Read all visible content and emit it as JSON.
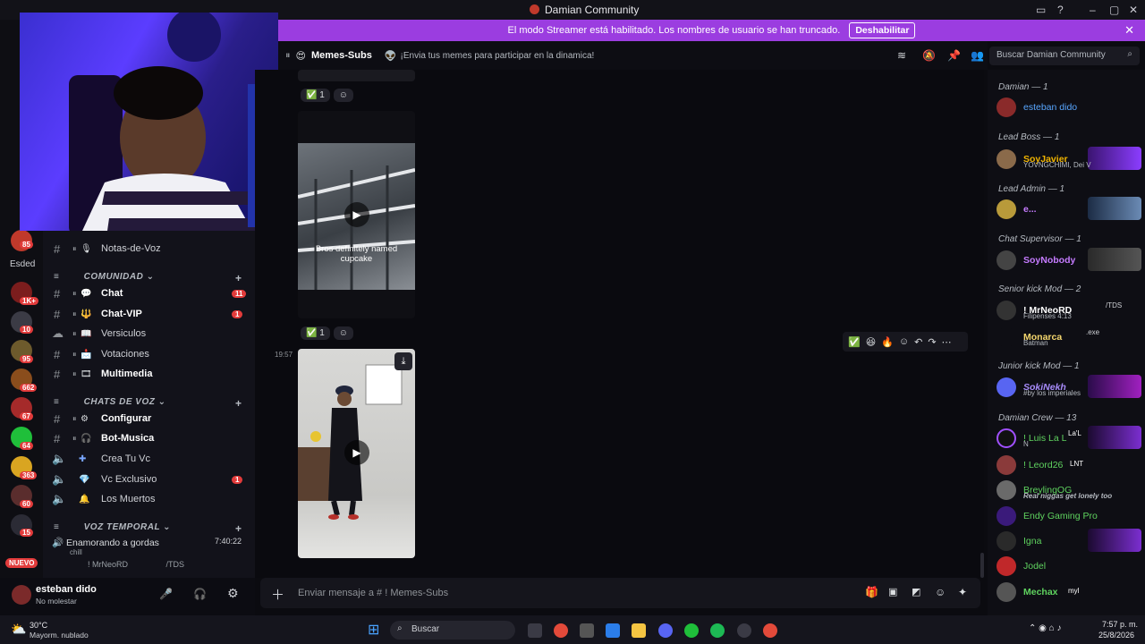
{
  "window": {
    "title": "Damian Community"
  },
  "banner": {
    "text": "El modo Streamer está habilitado. Los nombres de usuario se han truncado.",
    "button": "Deshabilitar"
  },
  "rail": {
    "badges": [
      "85",
      "1K+",
      "10",
      "95",
      "662",
      "67",
      "64",
      "363",
      "60",
      "15"
    ],
    "label": "Esded",
    "new_label": "NUEVO"
  },
  "channels": {
    "items": [
      {
        "name": "Notas-de-Voz",
        "bold": false,
        "badge": ""
      },
      {
        "category": "COMUNIDAD"
      },
      {
        "name": "Chat",
        "bold": true,
        "badge": "11"
      },
      {
        "name": "Chat-VIP",
        "bold": true,
        "badge": "1"
      },
      {
        "name": "Versiculos",
        "bold": false,
        "badge": ""
      },
      {
        "name": "Votaciones",
        "bold": false,
        "badge": ""
      },
      {
        "name": "Multimedia",
        "bold": true,
        "badge": ""
      },
      {
        "category": "CHATS DE VOZ"
      },
      {
        "name": "Configurar",
        "bold": true,
        "badge": ""
      },
      {
        "name": "Bot-Musica",
        "bold": true,
        "badge": ""
      },
      {
        "name": "Crea Tu Vc",
        "bold": false,
        "badge": ""
      },
      {
        "name": "Vc Exclusivo",
        "bold": false,
        "badge": "1"
      },
      {
        "name": "Los Muertos",
        "bold": false,
        "badge": ""
      },
      {
        "category": "VOZ TEMPORAL"
      }
    ],
    "voice_room": {
      "name": "Enamorando a gordas",
      "time": "7:40:22",
      "sub": "chill",
      "member": "! MrNeoRD",
      "member_tag": "/TDS"
    }
  },
  "user": {
    "name": "esteban dido",
    "status": "No molestar"
  },
  "chat": {
    "channel": "Memes-Subs",
    "topic": "¡Envia tus memes para participar en la dinamica!",
    "messages": [
      {
        "reaction_count": "1"
      },
      {
        "caption": "Bros definitely named cupcake",
        "reaction_count": "1"
      },
      {
        "time": "19:57"
      }
    ],
    "placeholder": "Enviar mensaje a # ! Memes-Subs",
    "search_placeholder": "Buscar Damian Community"
  },
  "members": [
    {
      "group": "Damian — 1"
    },
    {
      "name": "esteban dido",
      "color": "#58a6ff"
    },
    {
      "group": "Lead Boss — 1"
    },
    {
      "name": "SoyJavier",
      "sub": "YOVNGCHIMI, Dei V",
      "color": "#f0b400"
    },
    {
      "group": "Lead Admin — 1"
    },
    {
      "name": "e...",
      "color": "#c57bff"
    },
    {
      "group": "Chat Supervisor — 1"
    },
    {
      "name": "SoyNobody",
      "color": "#c57bff"
    },
    {
      "group": "Senior kick Mod — 2"
    },
    {
      "name": "! MrNeoRD",
      "sub": "Filipenses 4:13",
      "tag": "/TDS",
      "color": "#ffffff"
    },
    {
      "name": "Monarca",
      "sub": "Batman",
      "tag": ".exe",
      "color": "#f5d76e"
    },
    {
      "group": "Junior kick Mod — 1"
    },
    {
      "name": "SokiNekh",
      "sub": "#by los imperiales",
      "color": "#a78bfa"
    },
    {
      "group": "Damian Crew — 13"
    },
    {
      "name": "! Luis La L",
      "sub": "N",
      "tag": "La'L",
      "color": "#5fd35f"
    },
    {
      "name": "! Leord26",
      "tag": "LNT",
      "color": "#5fd35f"
    },
    {
      "name": "BreylingOG",
      "sub": "Real niggas get lonely too",
      "color": "#5fd35f"
    },
    {
      "name": "Endy Gaming Pro",
      "color": "#5fd35f"
    },
    {
      "name": "Igna",
      "color": "#5fd35f"
    },
    {
      "name": "Jodel",
      "color": "#5fd35f"
    },
    {
      "name": "Mechax",
      "tag": "myl",
      "color": "#5fd35f"
    }
  ],
  "taskbar": {
    "temp": "30°C",
    "weather": "Mayorm. nublado",
    "search": "Buscar",
    "time": "7:57 p. m.",
    "date": "25/8/2026"
  },
  "colors": {
    "accent": "#9b3de0",
    "badge": "#e23b3b"
  }
}
